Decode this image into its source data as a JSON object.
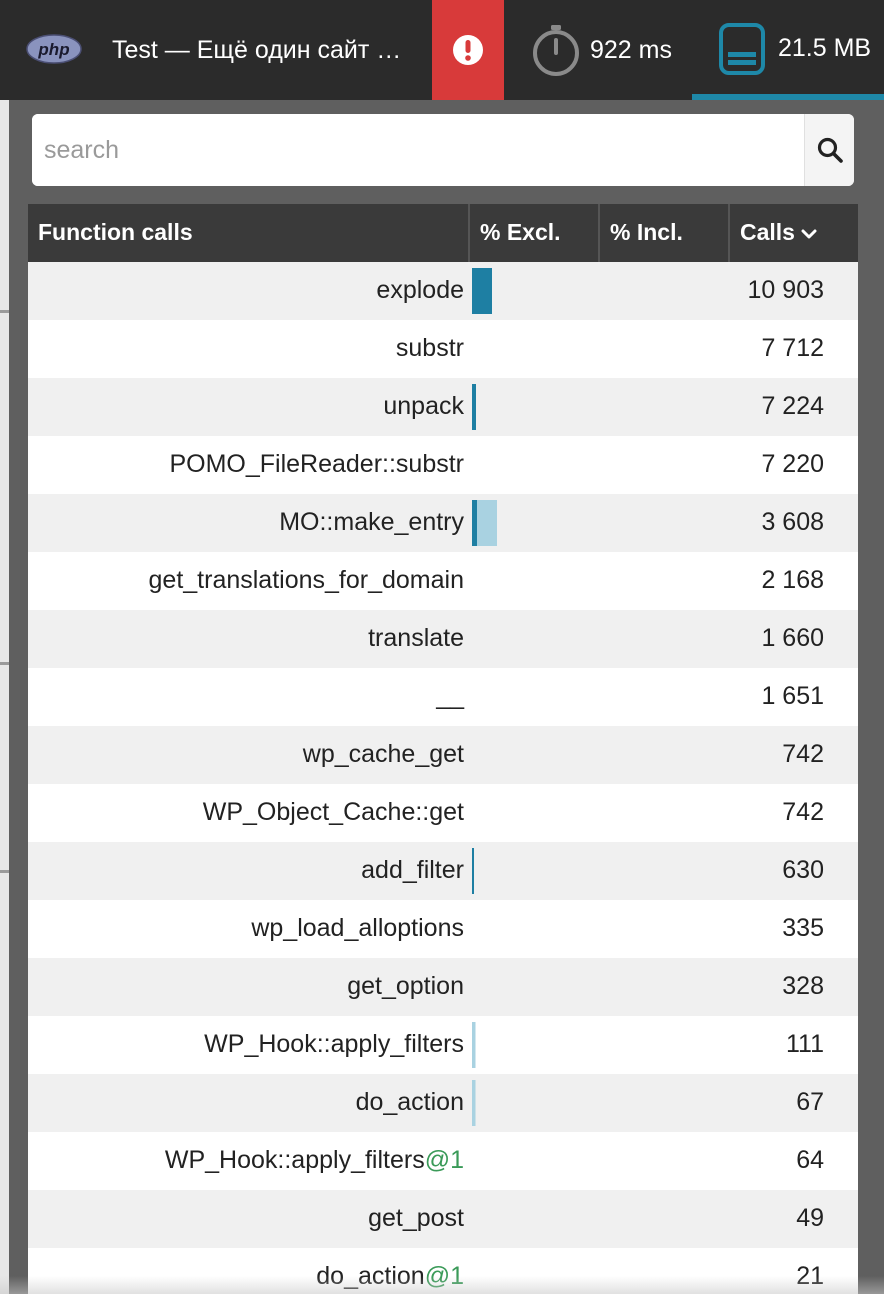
{
  "topbar": {
    "logo_text": "php",
    "site_title": "Test — Ещё один сайт …",
    "error_icon": "alert-circle-icon",
    "time_value": "922 ms",
    "time_icon": "stopwatch-icon",
    "memory_value": "21.5 MB",
    "memory_icon": "database-icon",
    "active_tab_color": "#1e88a8",
    "error_color": "#d83a3a"
  },
  "search": {
    "placeholder": "search",
    "value": ""
  },
  "table": {
    "headers": {
      "function": "Function calls",
      "excl": "% Excl.",
      "incl": "% Incl.",
      "calls": "Calls"
    },
    "sorted_by": "Calls",
    "sort_direction": "descending",
    "colors": {
      "excl_bar": "#1e7fa3",
      "incl_bar": "#a9d2e1"
    },
    "rows": [
      {
        "name": "explode",
        "suffix": "",
        "calls": "10 903",
        "excl": 4,
        "incl": 4
      },
      {
        "name": "substr",
        "suffix": "",
        "calls": "7 712",
        "excl": 0,
        "incl": 0
      },
      {
        "name": "unpack",
        "suffix": "",
        "calls": "7 224",
        "excl": 0.8,
        "incl": 0.8
      },
      {
        "name": "POMO_FileReader::substr",
        "suffix": "",
        "calls": "7 220",
        "excl": 0,
        "incl": 0
      },
      {
        "name": "MO::make_entry",
        "suffix": "",
        "calls": "3 608",
        "excl": 1,
        "incl": 5
      },
      {
        "name": "get_translations_for_domain",
        "suffix": "",
        "calls": "2 168",
        "excl": 0,
        "incl": 0
      },
      {
        "name": "translate",
        "suffix": "",
        "calls": "1 660",
        "excl": 0,
        "incl": 0
      },
      {
        "name": "__",
        "suffix": "",
        "calls": "1 651",
        "excl": 0,
        "incl": 0
      },
      {
        "name": "wp_cache_get",
        "suffix": "",
        "calls": "742",
        "excl": 0,
        "incl": 0
      },
      {
        "name": "WP_Object_Cache::get",
        "suffix": "",
        "calls": "742",
        "excl": 0,
        "incl": 0
      },
      {
        "name": "add_filter",
        "suffix": "",
        "calls": "630",
        "excl": 0.4,
        "incl": 0.4
      },
      {
        "name": "wp_load_alloptions",
        "suffix": "",
        "calls": "335",
        "excl": 0,
        "incl": 0
      },
      {
        "name": "get_option",
        "suffix": "",
        "calls": "328",
        "excl": 0,
        "incl": 0
      },
      {
        "name": "WP_Hook::apply_filters",
        "suffix": "",
        "calls": "111",
        "excl": 0,
        "incl": 0.7
      },
      {
        "name": "do_action",
        "suffix": "",
        "calls": "67",
        "excl": 0,
        "incl": 0.7
      },
      {
        "name": "WP_Hook::apply_filters",
        "suffix": "@1",
        "calls": "64",
        "excl": 0,
        "incl": 0
      },
      {
        "name": "get_post",
        "suffix": "",
        "calls": "49",
        "excl": 0,
        "incl": 0
      },
      {
        "name": "do_action",
        "suffix": "@1",
        "calls": "21",
        "excl": 0,
        "incl": 0
      }
    ]
  }
}
